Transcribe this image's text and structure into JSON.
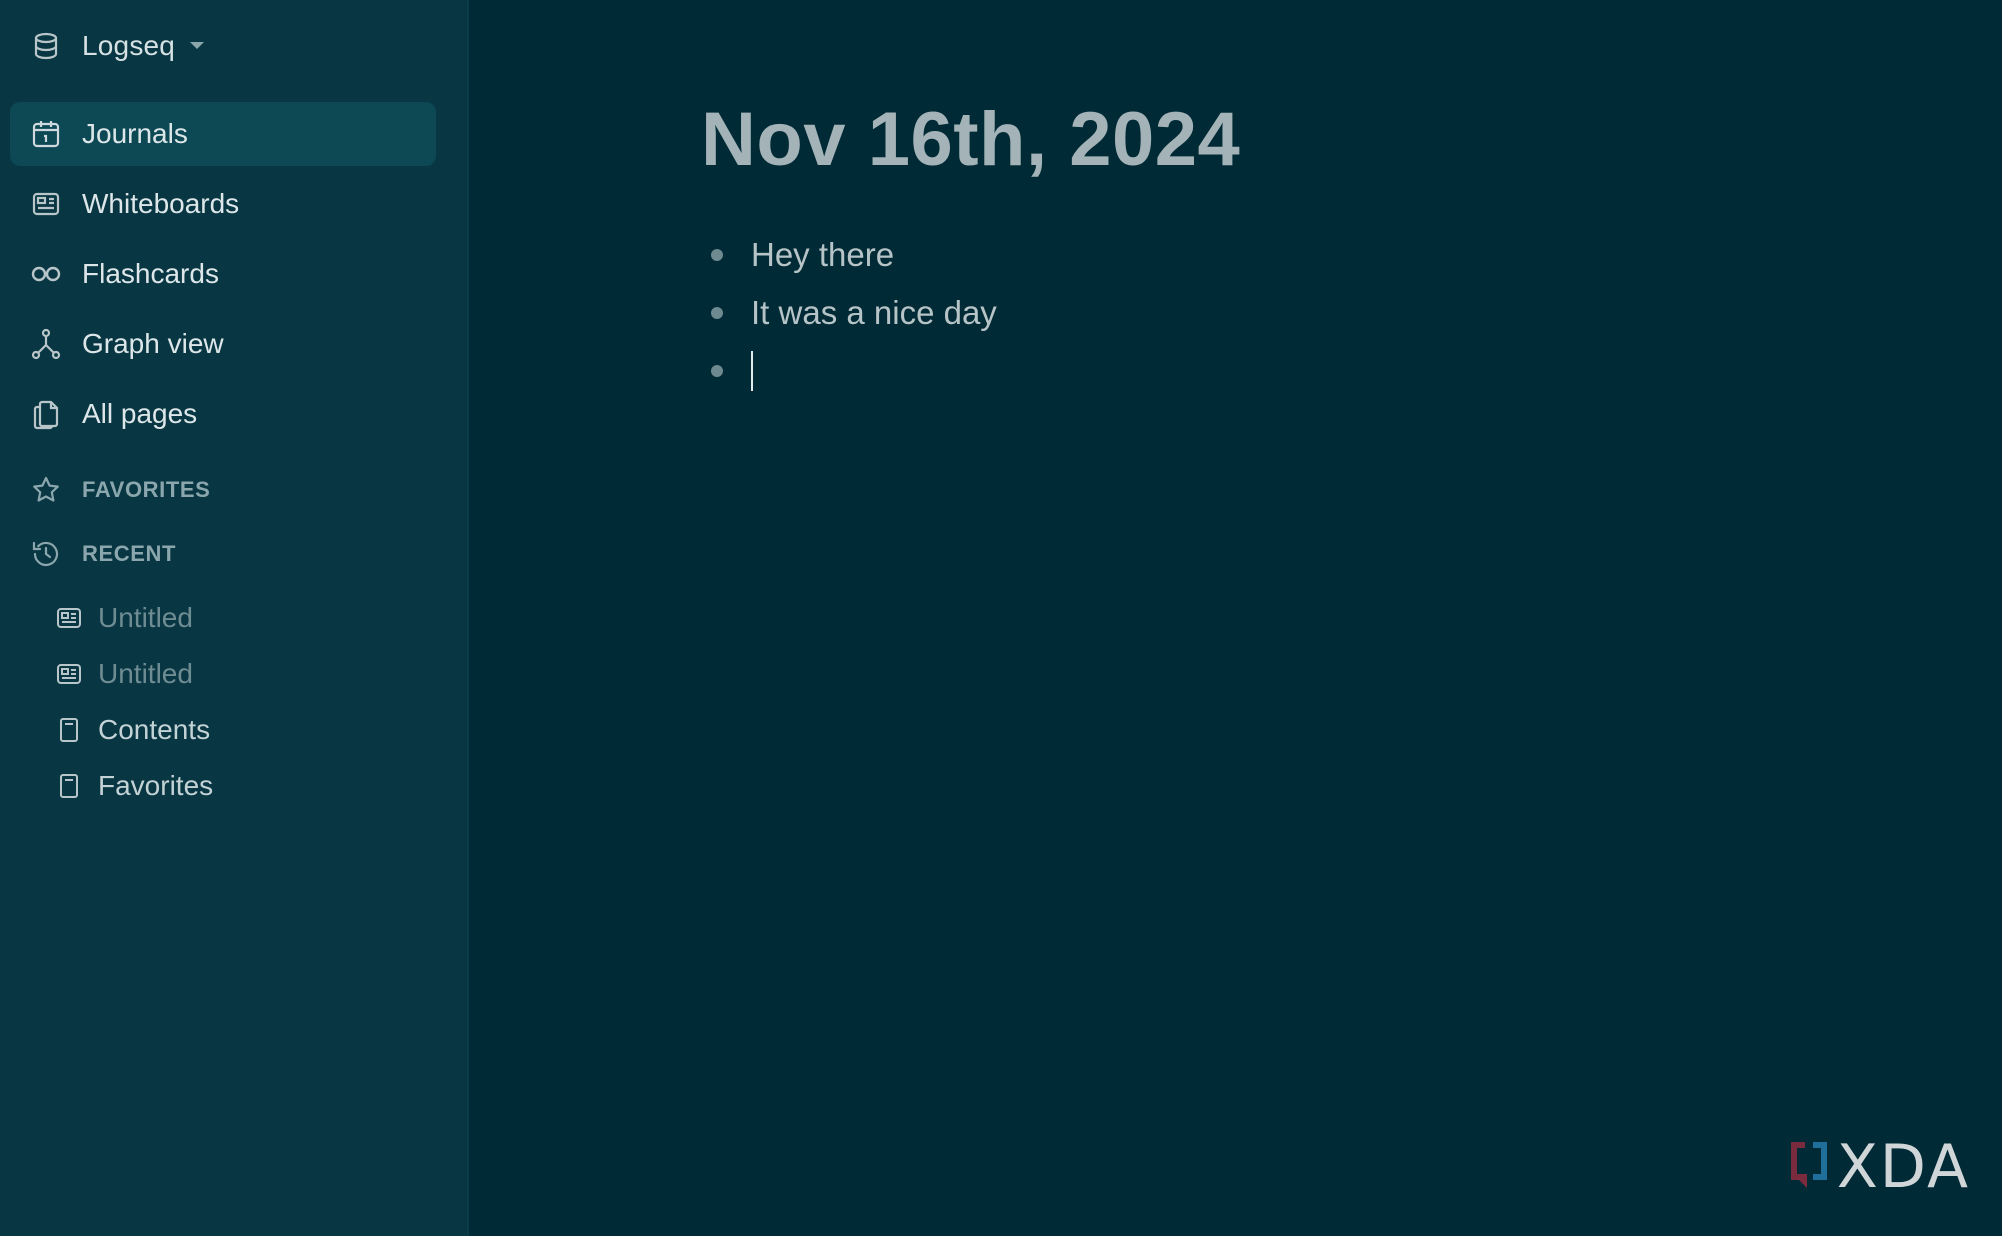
{
  "sidebar": {
    "graph": {
      "name": "Logseq",
      "icon": "database-icon",
      "caret_icon": "caret-down-icon"
    },
    "nav": [
      {
        "label": "Journals",
        "icon": "calendar-icon",
        "active": true
      },
      {
        "label": "Whiteboards",
        "icon": "whiteboard-icon",
        "active": false
      },
      {
        "label": "Flashcards",
        "icon": "infinity-icon",
        "active": false
      },
      {
        "label": "Graph view",
        "icon": "graph-icon",
        "active": false
      },
      {
        "label": "All pages",
        "icon": "pages-icon",
        "active": false
      }
    ],
    "favorites": {
      "label": "FAVORITES",
      "icon": "star-icon"
    },
    "recent": {
      "label": "RECENT",
      "icon": "history-icon",
      "items": [
        {
          "label": "Untitled",
          "icon": "whiteboard-icon"
        },
        {
          "label": "Untitled",
          "icon": "whiteboard-icon"
        },
        {
          "label": "Contents",
          "icon": "page-icon"
        },
        {
          "label": "Favorites",
          "icon": "page-icon"
        }
      ]
    }
  },
  "journal": {
    "title": "Nov 16th, 2024",
    "blocks": [
      {
        "text": "Hey there"
      },
      {
        "text": "It was a nice day"
      },
      {
        "text": "",
        "editing": true
      }
    ]
  },
  "watermark": {
    "text": "XDA"
  },
  "colors": {
    "background": "#002a35",
    "sidebar": "#083643",
    "active_item": "#0d4855",
    "title": "#a3b3b7",
    "text": "#b6c4c7"
  }
}
